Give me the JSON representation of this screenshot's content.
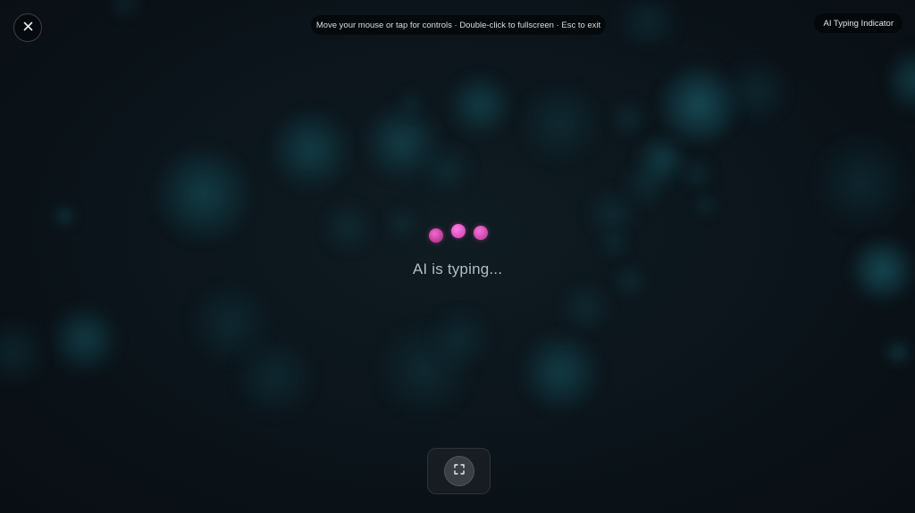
{
  "header": {
    "close_icon": "close-icon",
    "hint": "Move your mouse or tap for controls · Double-click to fullscreen · Esc to exit",
    "title": "AI Typing Indicator"
  },
  "main": {
    "status": "AI is typing...",
    "dot_colors": [
      "#d24bb0",
      "#e055c4",
      "#d24bb0"
    ]
  },
  "controls": {
    "fullscreen_icon": "fullscreen-icon"
  },
  "colors": {
    "background": "#0b1117",
    "bokeh": "#185c68",
    "accent": "#e055c4"
  }
}
